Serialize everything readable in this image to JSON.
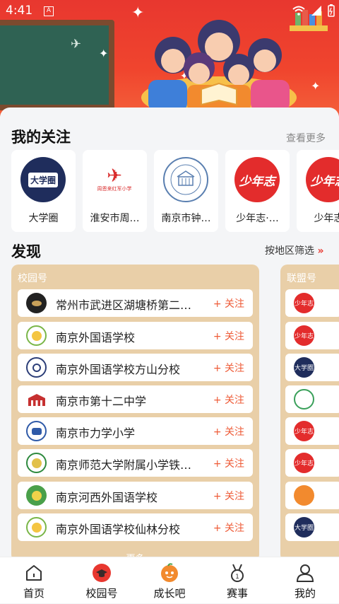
{
  "status_bar": {
    "time": "4:41",
    "a_badge": "A"
  },
  "follow_section": {
    "title": "我的关注",
    "more": "查看更多",
    "items": [
      {
        "name": "大学圈",
        "logo_text": "大学圈"
      },
      {
        "name": "淮安市周…",
        "logo_text": "周恩来红军小学"
      },
      {
        "name": "南京市钟…",
        "logo_text": ""
      },
      {
        "name": "少年志·…",
        "logo_text": "少年志"
      },
      {
        "name": "少年志",
        "logo_text": "少年志"
      }
    ]
  },
  "discover_section": {
    "title": "发现",
    "filter": "按地区筛选",
    "school_panel": {
      "label": "校园号",
      "follow_label": "+ 关注",
      "more": "更多",
      "items": [
        {
          "name": "常州市武进区湖塘桥第二…"
        },
        {
          "name": "南京外国语学校"
        },
        {
          "name": "南京外国语学校方山分校"
        },
        {
          "name": "南京市第十二中学"
        },
        {
          "name": "南京市力学小学"
        },
        {
          "name": "南京师范大学附属小学铁…"
        },
        {
          "name": "南京河西外国语学校"
        },
        {
          "name": "南京外国语学校仙林分校"
        }
      ]
    },
    "league_panel": {
      "label": "联盟号",
      "items": [
        {
          "logo_text": "少年志"
        },
        {
          "logo_text": "少年志"
        },
        {
          "logo_text": "大学圈"
        },
        {
          "logo_text": ""
        },
        {
          "logo_text": "少年志"
        },
        {
          "logo_text": "少年志"
        },
        {
          "logo_text": ""
        },
        {
          "logo_text": "大学圈"
        }
      ]
    }
  },
  "tabbar": {
    "tabs": [
      {
        "label": "首页",
        "icon": "home-icon"
      },
      {
        "label": "校园号",
        "icon": "campus-icon"
      },
      {
        "label": "成长吧",
        "icon": "growth-icon"
      },
      {
        "label": "赛事",
        "icon": "medal-icon"
      },
      {
        "label": "我的",
        "icon": "user-icon"
      }
    ]
  },
  "colors": {
    "accent": "#ee5a36",
    "panel": "#e9cfa8",
    "brand_red": "#e8372f"
  }
}
